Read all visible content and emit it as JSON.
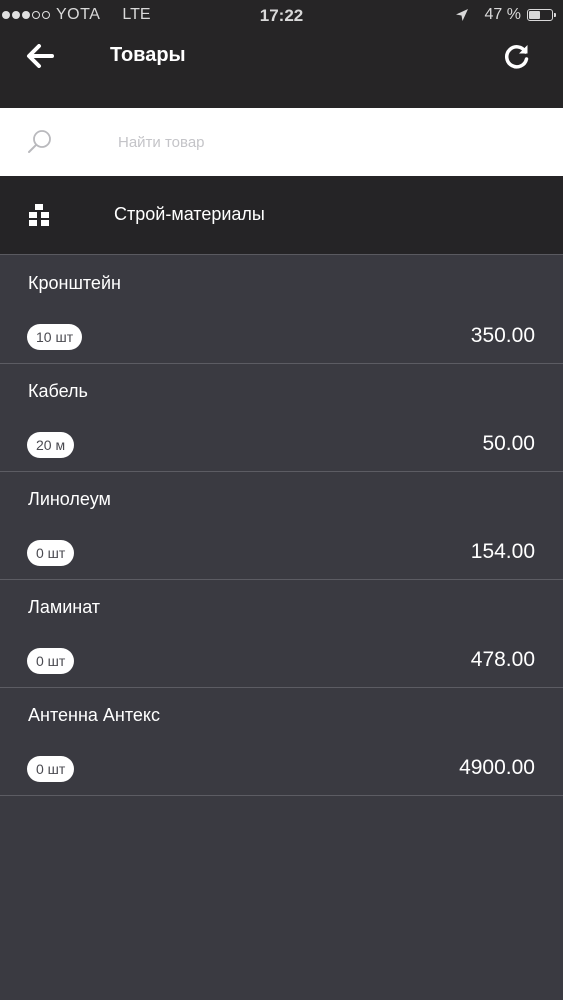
{
  "status_bar": {
    "carrier": "YOTA",
    "network": "LTE",
    "time": "17:22",
    "battery": "47 %",
    "battery_level": 0.47
  },
  "header": {
    "title": "Товары",
    "back_icon": "arrow-left-icon",
    "refresh_icon": "refresh-icon"
  },
  "search": {
    "placeholder": "Найти товар",
    "value": ""
  },
  "category": {
    "label": "Строй-материалы",
    "icon": "boxes-icon"
  },
  "products": [
    {
      "name": "Кронштейн",
      "quantity": "10 шт",
      "price": "350.00"
    },
    {
      "name": "Кабель",
      "quantity": "20 м",
      "price": "50.00"
    },
    {
      "name": "Линолеум",
      "quantity": "0 шт",
      "price": "154.00"
    },
    {
      "name": "Ламинат",
      "quantity": "0 шт",
      "price": "478.00"
    },
    {
      "name": "Антенна Антекс",
      "quantity": "0 шт",
      "price": "4900.00"
    }
  ],
  "colors": {
    "header_bg": "#262526",
    "list_bg": "#3a3a41",
    "divider": "#5c5c63",
    "badge_bg": "#ffffff"
  }
}
